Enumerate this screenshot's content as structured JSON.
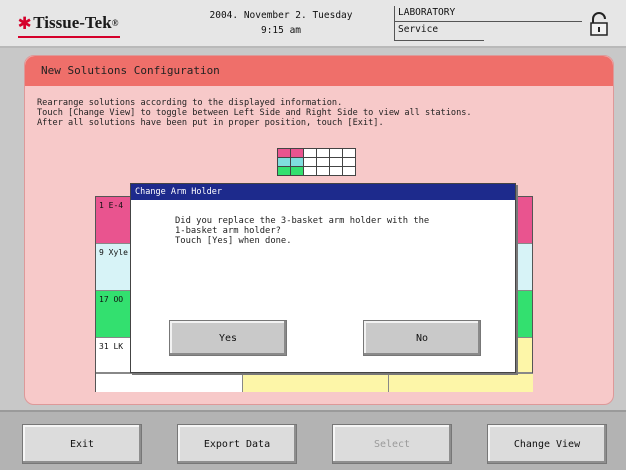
{
  "header": {
    "brand": "Tissue-Tek",
    "brand_mark": "®",
    "date": "2004. November 2. Tuesday",
    "time": "9:15 am",
    "location": "LABORATORY",
    "mode": "Service",
    "lock_icon": "lock-icon"
  },
  "panel": {
    "title": "New Solutions Configuration",
    "instructions": "Rearrange solutions according to the displayed information.\nTouch [Change View] to toggle between Left Side and Right Side to view all stations.\nAfter all solutions have been put in proper position, touch [Exit].",
    "stations": [
      {
        "label": "1 E-4",
        "color": "#e9548f"
      },
      {
        "label": "9 Xyle",
        "color": "#d7f3f7"
      },
      {
        "label": "17 OO",
        "color": "#33e06f"
      },
      {
        "label": "31 LK",
        "color": "#ffffff"
      }
    ],
    "right_colors": [
      "#e9548f",
      "#d7f3f7",
      "#33e06f",
      "#fdf6a8"
    ],
    "bottom_cells": [
      "#ffffff",
      "#fdf6a8",
      "#fdf6a8"
    ]
  },
  "dialog": {
    "title": "Change Arm Holder",
    "message": "Did you replace the 3-basket arm holder with the\n1-basket arm holder?\nTouch [Yes] when done.",
    "yes_label": "Yes",
    "no_label": "No"
  },
  "toolbar": {
    "exit_label": "Exit",
    "export_label": "Export Data",
    "select_label": "Select",
    "change_view_label": "Change View"
  }
}
